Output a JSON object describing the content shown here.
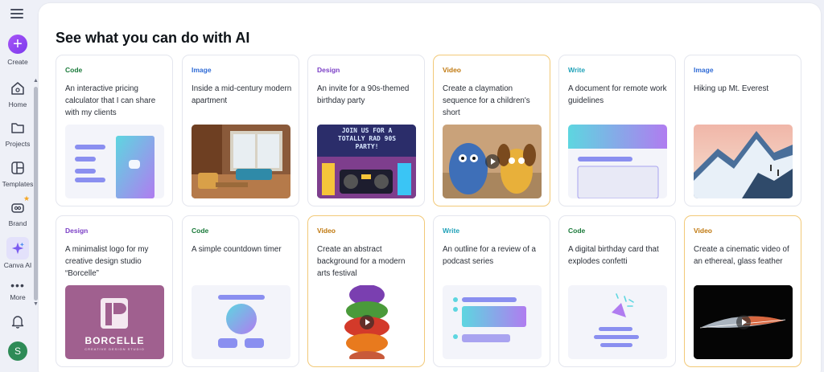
{
  "sidebar": {
    "items": [
      {
        "label": "Create"
      },
      {
        "label": "Home"
      },
      {
        "label": "Projects"
      },
      {
        "label": "Templates"
      },
      {
        "label": "Brand"
      },
      {
        "label": "Canva AI"
      },
      {
        "label": "More"
      }
    ],
    "avatar_initial": "S"
  },
  "main": {
    "heading": "See what you can do with AI",
    "cards": [
      {
        "category": "Code",
        "description": "An interactive pricing calculator that I can share with my clients"
      },
      {
        "category": "Image",
        "description": "Inside a mid-century modern apartment"
      },
      {
        "category": "Design",
        "description": "An invite for a 90s-themed birthday party",
        "thumb_text": "JOIN US FOR A TOTALLY RAD 90S PARTY!"
      },
      {
        "category": "Video",
        "description": "Create a claymation sequence for a children's short"
      },
      {
        "category": "Write",
        "description": "A document for remote work guidelines"
      },
      {
        "category": "Image",
        "description": "Hiking up Mt. Everest"
      },
      {
        "category": "Design",
        "description": "A minimalist logo for my creative design studio “Borcelle”",
        "thumb_text": "BORCELLE",
        "thumb_subtext": "CREATIVE DESIGN STUDIO"
      },
      {
        "category": "Code",
        "description": "A simple countdown timer"
      },
      {
        "category": "Video",
        "description": "Create an abstract background for a modern arts festival"
      },
      {
        "category": "Write",
        "description": "An outline for a review of a podcast series"
      },
      {
        "category": "Code",
        "description": "A digital birthday card that explodes confetti"
      },
      {
        "category": "Video",
        "description": "Create a cinematic video of an ethereal, glass feather"
      }
    ]
  },
  "colors": {
    "code": "#1a7a3a",
    "image": "#2f6bd6",
    "design": "#7b3fc6",
    "video": "#c0780e",
    "write": "#1fa1b8",
    "accent": "#8b3dff"
  }
}
